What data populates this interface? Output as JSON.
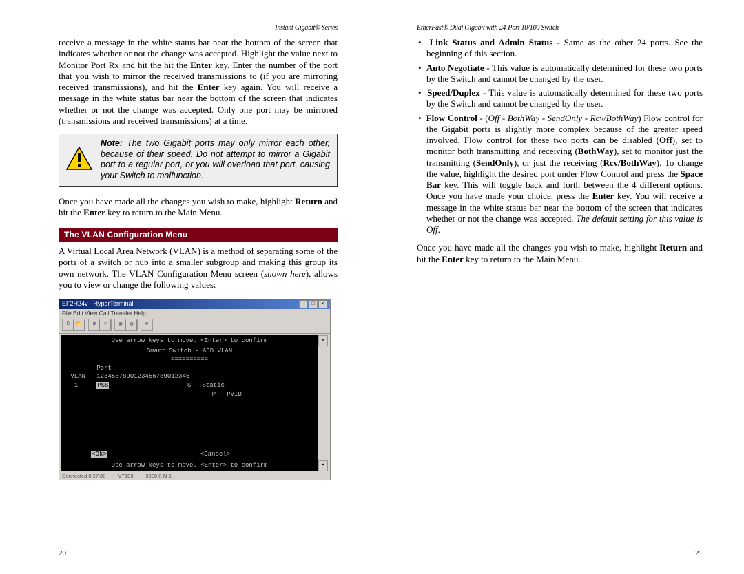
{
  "left": {
    "header": "Instant Gigabit® Series",
    "para1_pre": "receive a message in the white status bar near the bottom of the screen that indicates whether or not the change was accepted.  Highlight the value next to Monitor Port Rx and hit the hit the ",
    "enter": "Enter",
    "para1_mid1": " key.  Enter the number of the port that you wish to mirror the received transmissions to (if you are mirroring received transmissions), and hit the ",
    "para1_mid2": " key again.  You will receive a message in the white status bar near the bottom of the screen that indicates whether or not the change was accepted.  Only one port may be mirrored (transmissions and received transmissions) at a time.",
    "note_label": "Note:",
    "note_text": " The two Gigabit ports may only mirror each other, because of their speed.  Do not attempt to mirror a Gigabit port to a regular port, or you will overload that port, causing your Switch to malfunction.",
    "para2_pre": "Once you have made all the changes you wish to make, highlight ",
    "return": "Return",
    "para2_mid": " and hit the ",
    "para2_post": " key to return to the Main Menu.",
    "section_title": "The VLAN Configuration Menu",
    "para3_a": "A Virtual Local Area Network (VLAN) is a method of separating some of the ports of a switch or hub into a smaller subgroup and making this group its own network.  The VLAN Configuration Menu screen (",
    "shown": "shown here",
    "para3_b": "), allows you to view or change the following values:",
    "pageno": "20",
    "ss": {
      "title": "EF2H24v - HyperTerminal",
      "menus": "File  Edit  View  Call  Transfer  Help",
      "hint": "Use arrow keys to move. <Enter> to confirm",
      "heading": "Smart Switch - ADD VLAN",
      "underline": "==========",
      "hdr_port": "Port",
      "row_vlan_l": "VLAN",
      "row_vlan_r": "1234567890123456789012345",
      "row1_l": "1",
      "row1_r": "PSS",
      "legend1": "S - Static",
      "legend2": "P - PVID",
      "btn_ok": "<Ok>",
      "btn_cancel": "<Cancel>",
      "bottomhint": "Use arrow keys to move. <Enter> to confirm",
      "status1": "Connected 0:27:00",
      "status2": "VT100",
      "status3": "9600 8-N-1"
    }
  },
  "right": {
    "header": "EtherFast® Dual Gigabit with 24-Port 10/100 Switch",
    "b1_label": "Link Status and Admin Status",
    "b1_body": " - Same as the other 24 ports.  See the beginning of this section.",
    "b2_label": "Auto Negotiate",
    "b2_body": " -  This value is automatically determined for these two ports by the Switch and cannot be changed by the user.",
    "b3_label": "Speed/Duplex",
    "b3_body": " - This value is automatically determined for these two ports by the Switch and cannot be changed by the user.",
    "b4_label": "Flow Control",
    "b4_dash": " - ",
    "b4_opts": "Off - BothWay - SendOnly - Rcv/BothWay",
    "b4_p1": ") Flow control for the Gigabit ports is slightly more complex because of the greater speed involved.  Flow control for these two ports can be disabled (",
    "off": "Off",
    "b4_p2": "), set to monitor both transmitting and receiving (",
    "both": "BothWay",
    "b4_p3": "), set to monitor just the transmitting (",
    "send": "SendOnly",
    "b4_p4": "), or just the receiving (",
    "rcv": "Rcv/BothWay",
    "b4_p5": ").  To change the value, highlight the desired port under Flow Control and press the ",
    "space": "Space Bar",
    "b4_p6": " key.  This will toggle back and forth between the 4 different options.  Once you have made your choice, press the ",
    "enter": "Enter",
    "b4_p7": " key.  You will receive a message in the white status bar near the bottom of the screen that indicates whether or not the change was accepted.  ",
    "b4_def": "The default setting for this value is Off",
    "b4_end": ".",
    "after_pre": "Once you have made all the changes you wish to make, highlight ",
    "return": "Return",
    "after_mid": " and hit the ",
    "after_post": " key to return to the Main Menu.",
    "pageno": "21"
  }
}
